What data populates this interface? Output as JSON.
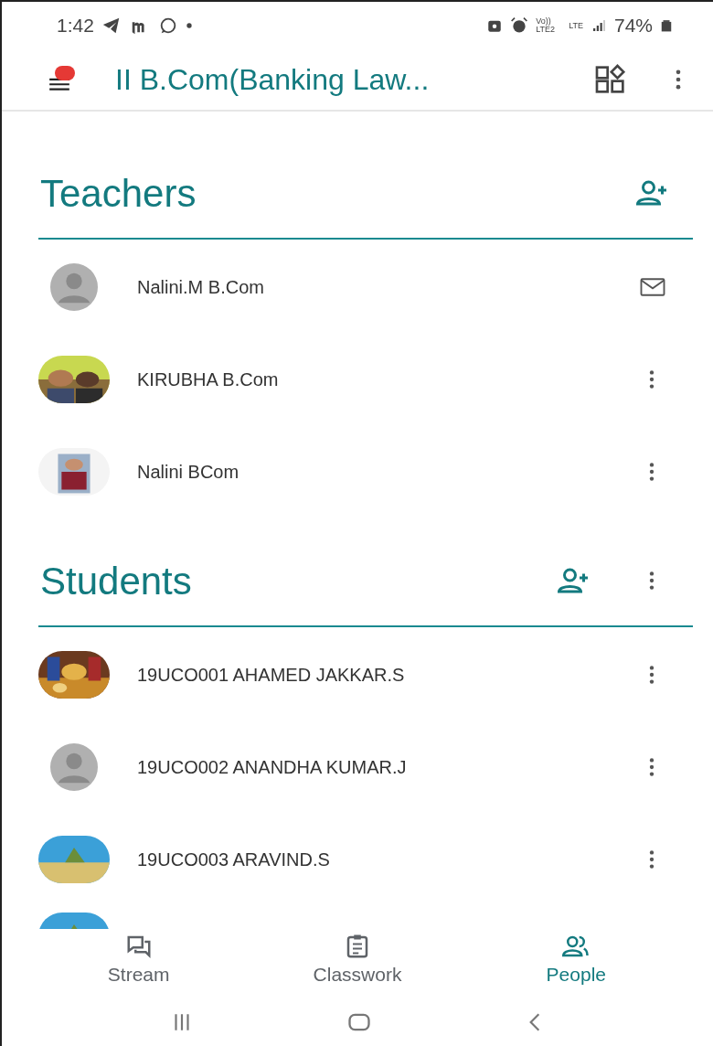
{
  "status_bar": {
    "time": "1:42",
    "network": "Vo)) LTE2",
    "data": "LTE",
    "battery": "74%"
  },
  "app_bar": {
    "title": "II B.Com(Banking Law...",
    "notification_dot": true
  },
  "sections": [
    {
      "title": "Teachers",
      "more_menu": false,
      "people": [
        {
          "name": "Nalini.M B.Com",
          "photo": false,
          "mail_button": true
        },
        {
          "name": "KIRUBHA B.Com",
          "photo": true,
          "mail_button": false
        },
        {
          "name": "Nalini BCom",
          "photo": true,
          "mail_button": false
        }
      ]
    },
    {
      "title": "Students",
      "more_menu": true,
      "people": [
        {
          "name": "19UCO001 AHAMED JAKKAR.S",
          "photo": true,
          "mail_button": false
        },
        {
          "name": "19UCO002 ANANDHA KUMAR.J",
          "photo": false,
          "mail_button": false
        },
        {
          "name": "19UCO003 ARAVIND.S",
          "photo": true,
          "mail_button": false
        }
      ]
    }
  ],
  "bottom_nav": [
    {
      "label": "Stream",
      "kind": "stream",
      "selected": false
    },
    {
      "label": "Classwork",
      "kind": "classwork",
      "selected": false
    },
    {
      "label": "People",
      "kind": "people",
      "selected": true
    }
  ]
}
